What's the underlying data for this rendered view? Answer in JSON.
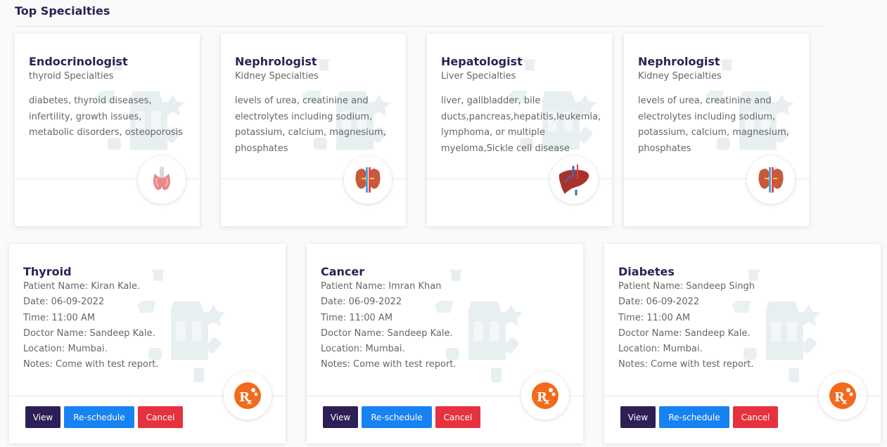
{
  "section_title": "Top Specialties",
  "specialties": [
    {
      "title": "Endocrinologist",
      "subtitle": "thyroid Specialties",
      "description": "diabetes, thyroid diseases, infertility, growth issues, metabolic disorders, osteoporosis",
      "icon": "thyroid-icon"
    },
    {
      "title": "Nephrologist",
      "subtitle": "Kidney Specialties",
      "description": "levels of urea, creatinine and electrolytes including sodium, potassium, calcium, magnesium, phosphates",
      "icon": "kidney-icon"
    },
    {
      "title": "Hepatologist",
      "subtitle": "Liver Specialties",
      "description": "liver, gallbladder, bile ducts,pancreas,hepatitis,leukemia, lymphoma, or multiple myeloma,Sickle cell disease",
      "icon": "liver-icon"
    },
    {
      "title": "Nephrologist",
      "subtitle": "Kidney Specialties",
      "description": "levels of urea, creatinine and electrolytes including sodium, potassium, calcium, magnesium, phosphates",
      "icon": "kidney-icon"
    }
  ],
  "appointments": [
    {
      "title": "Thyroid",
      "patient": "Patient Name: Kiran Kale.",
      "date": "Date: 06-09-2022",
      "time": "Time: 11:00 AM",
      "doctor": "Doctor Name: Sandeep Kale.",
      "location": "Location: Mumbai.",
      "notes": "Notes: Come with test report."
    },
    {
      "title": "Cancer",
      "patient": "Patient Name: Imran Khan",
      "date": "Date: 06-09-2022",
      "time": "Time: 11:00 AM",
      "doctor": "Doctor Name: Sandeep Kale.",
      "location": "Location: Mumbai.",
      "notes": "Notes: Come with test report."
    },
    {
      "title": "Diabetes",
      "patient": "Patient Name: Sandeep Singh",
      "date": "Date: 06-09-2022",
      "time": "Time: 11:00 AM",
      "doctor": "Doctor Name: Sandeep Kale.",
      "location": "Location: Mumbai.",
      "notes": "Notes: Come with test report."
    }
  ],
  "buttons": {
    "view": "View",
    "reschedule": "Re-schedule",
    "cancel": "Cancel"
  },
  "colors": {
    "title": "#2d1f55",
    "view_button": "#2d1f55",
    "reschedule_button": "#1782f2",
    "cancel_button": "#e6323e",
    "rx_orange": "#f26a1b"
  }
}
